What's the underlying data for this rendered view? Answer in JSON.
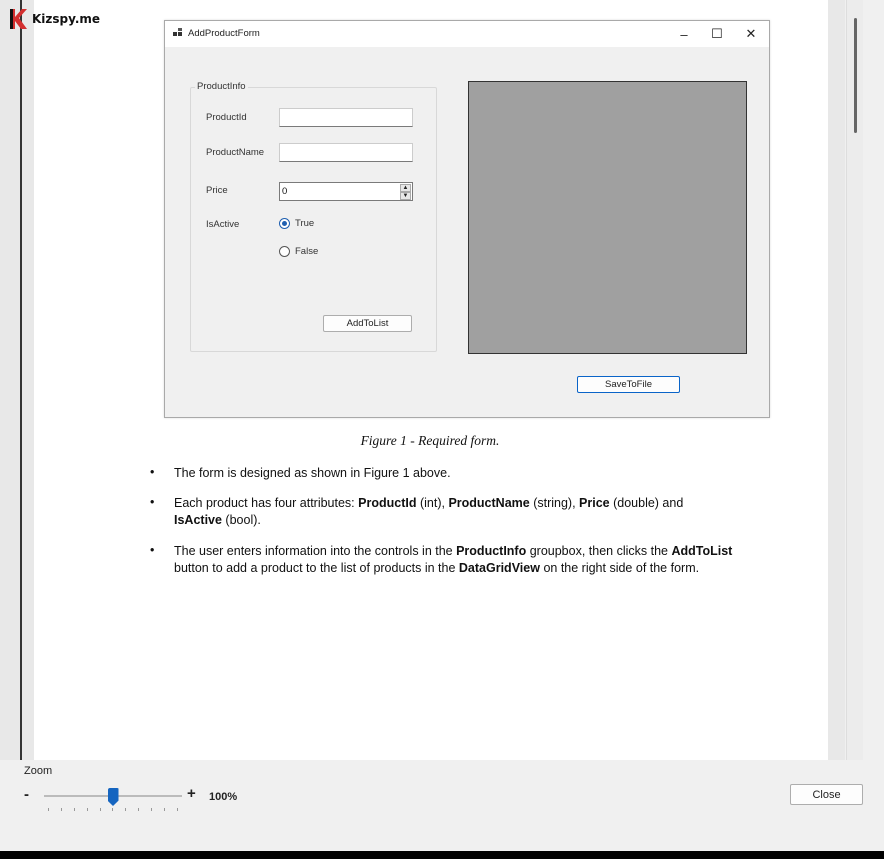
{
  "logo": {
    "text": "Kizspy.me",
    "color": "#d32f2f"
  },
  "form": {
    "title": "AddProductForm",
    "title_buttons": {
      "minimize": "–",
      "maximize": "☐",
      "close": "✕"
    },
    "groupbox_label": "ProductInfo",
    "fields": {
      "product_id_label": "ProductId",
      "product_id_value": "",
      "product_name_label": "ProductName",
      "product_name_value": "",
      "price_label": "Price",
      "price_value": "0",
      "is_active_label": "IsActive"
    },
    "radios": {
      "true_label": "True",
      "true_checked": true,
      "false_label": "False",
      "false_checked": false
    },
    "add_button": "AddToList",
    "save_button": "SaveToFile",
    "grid_color": "#a0a0a0"
  },
  "caption": "Figure 1 - Required form.",
  "bullets": [
    {
      "text": "The form is designed as shown in Figure 1 above."
    },
    {
      "p1": "Each product has four attributes: ",
      "b1": "ProductId",
      "p2": " (int), ",
      "b2": "ProductName",
      "p3": " (string), ",
      "b3": "Price",
      "p4": " (double) and ",
      "b4": "IsActive",
      "p5": " (bool)."
    },
    {
      "p1": "The user enters information into the controls in the ",
      "b1": "ProductInfo",
      "p2": " groupbox, then clicks the ",
      "b2": "AddToList",
      "p3": " button to add a product to the list of products in the ",
      "b3": "DataGridView",
      "p4": " on the right side of the form."
    }
  ],
  "viewer": {
    "zoom_label": "Zoom",
    "zoom_minus": "-",
    "zoom_plus": "+",
    "zoom_value": "100%",
    "zoom_level": 0.5,
    "close_button": "Close",
    "accent": "#1565c0"
  }
}
